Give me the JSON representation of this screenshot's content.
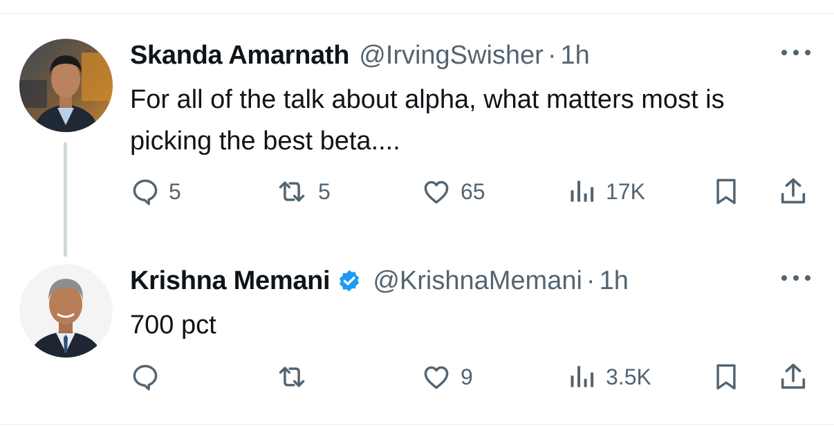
{
  "tweets": [
    {
      "author": "Skanda Amarnath",
      "handle": "@IrvingSwisher",
      "separator": "·",
      "time": "1h",
      "verified": false,
      "text": "For all of the talk about alpha, what matters most is picking the best beta....",
      "replies": "5",
      "reposts": "5",
      "likes": "65",
      "views": "17K"
    },
    {
      "author": "Krishna Memani",
      "handle": "@KrishnaMemani",
      "separator": "·",
      "time": "1h",
      "verified": true,
      "text": "700 pct",
      "replies": "",
      "reposts": "",
      "likes": "9",
      "views": "3.5K"
    }
  ],
  "colors": {
    "icon": "#536471",
    "verified": "#1d9bf0",
    "thread_line": "#cfd9de"
  },
  "icons": [
    "reply-icon",
    "repost-icon",
    "like-icon",
    "views-icon",
    "bookmark-icon",
    "share-icon",
    "more-icon",
    "verified-icon"
  ]
}
